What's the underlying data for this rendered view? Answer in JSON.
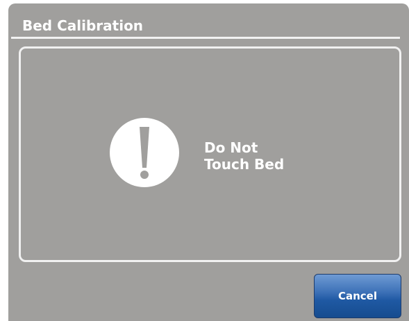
{
  "dialog": {
    "title": "Bed Calibration",
    "message_line1": "Do Not",
    "message_line2": "Touch Bed",
    "icon": "exclamation-icon",
    "cancel_label": "Cancel"
  },
  "colors": {
    "panel_background": "#a09f9d",
    "text": "#ffffff",
    "button_blue": "#2a62ad"
  }
}
